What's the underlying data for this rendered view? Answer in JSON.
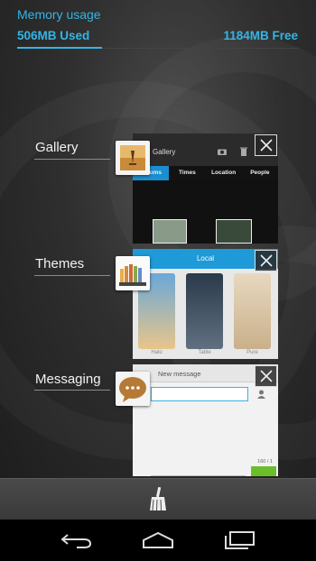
{
  "memory": {
    "title": "Memory usage",
    "used": "506MB Used",
    "free": "1184MB Free",
    "used_fraction": 0.3
  },
  "apps": [
    {
      "label": "Gallery",
      "icon": "gallery-icon",
      "thumb": {
        "title": "Gallery",
        "tabs": [
          "Albums",
          "Times",
          "Location",
          "People"
        ],
        "active_tab": 0
      }
    },
    {
      "label": "Themes",
      "icon": "themes-icon",
      "thumb": {
        "title": "Local",
        "cards": [
          "Halo",
          "Table",
          "Pure"
        ]
      }
    },
    {
      "label": "Messaging",
      "icon": "messaging-icon",
      "thumb": {
        "title": "New message",
        "counter": "160 / 1"
      }
    }
  ],
  "bottom": {
    "clean_icon": "broom-icon",
    "nav": [
      "back-icon",
      "home-icon",
      "recent-apps-icon"
    ]
  },
  "colors": {
    "accent": "#33b5e5",
    "send": "#6cbd2a"
  }
}
